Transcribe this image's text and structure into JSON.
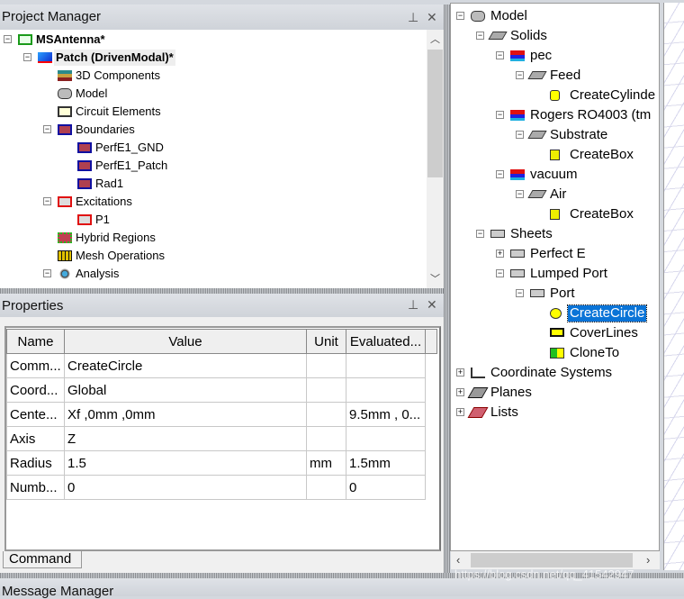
{
  "project_manager": {
    "title": "Project Manager",
    "pin_icon": "pin-icon",
    "close_icon": "close-icon",
    "items": [
      {
        "label": "MSAntenna*",
        "level": 0,
        "exp": "-",
        "icon": "project-icon",
        "bold": true
      },
      {
        "label": "Patch (DrivenModal)*",
        "level": 1,
        "exp": "-",
        "icon": "design-icon",
        "bold": true,
        "highlight": true
      },
      {
        "label": "3D Components",
        "level": 2,
        "icon": "3d-components-icon"
      },
      {
        "label": "Model",
        "level": 2,
        "icon": "model-icon"
      },
      {
        "label": "Circuit Elements",
        "level": 2,
        "icon": "circuit-elements-icon"
      },
      {
        "label": "Boundaries",
        "level": 2,
        "exp": "-",
        "icon": "boundary-icon"
      },
      {
        "label": "PerfE1_GND",
        "level": 3,
        "icon": "boundary-icon"
      },
      {
        "label": "PerfE1_Patch",
        "level": 3,
        "icon": "boundary-icon"
      },
      {
        "label": "Rad1",
        "level": 3,
        "icon": "boundary-icon"
      },
      {
        "label": "Excitations",
        "level": 2,
        "exp": "-",
        "icon": "excitation-icon"
      },
      {
        "label": "P1",
        "level": 3,
        "icon": "excitation-icon"
      },
      {
        "label": "Hybrid Regions",
        "level": 2,
        "icon": "hybrid-regions-icon"
      },
      {
        "label": "Mesh Operations",
        "level": 2,
        "icon": "mesh-icon"
      },
      {
        "label": "Analysis",
        "level": 2,
        "exp": "-",
        "icon": "analysis-icon"
      }
    ]
  },
  "properties": {
    "title": "Properties",
    "columns": [
      "Name",
      "Value",
      "Unit",
      "Evaluated..."
    ],
    "rows": [
      [
        "Comm...",
        "CreateCircle",
        "",
        ""
      ],
      [
        "Coord...",
        "Global",
        "",
        ""
      ],
      [
        "Cente...",
        "Xf ,0mm ,0mm",
        "",
        "9.5mm , 0..."
      ],
      [
        "Axis",
        "Z",
        "",
        ""
      ],
      [
        "Radius",
        "1.5",
        "mm",
        "1.5mm"
      ],
      [
        "Numb...",
        "0",
        "",
        "0"
      ]
    ],
    "tab": "Command"
  },
  "message_manager": {
    "title": "Message Manager"
  },
  "model_tree": {
    "items": [
      {
        "label": "Model",
        "level": 0,
        "exp": "-",
        "icon": "model-icon"
      },
      {
        "label": "Solids",
        "level": 1,
        "exp": "-",
        "icon": "solid-icon"
      },
      {
        "label": "pec",
        "level": 2,
        "exp": "-",
        "icon": "material-icon"
      },
      {
        "label": "Feed",
        "level": 3,
        "exp": "-",
        "icon": "solid-icon"
      },
      {
        "label": "CreateCylinde",
        "level": 4,
        "icon": "cylinder-icon"
      },
      {
        "label": "Rogers RO4003 (tm",
        "level": 2,
        "exp": "-",
        "icon": "material-icon"
      },
      {
        "label": "Substrate",
        "level": 3,
        "exp": "-",
        "icon": "solid-icon"
      },
      {
        "label": "CreateBox",
        "level": 4,
        "icon": "box-icon"
      },
      {
        "label": "vacuum",
        "level": 2,
        "exp": "-",
        "icon": "material-icon"
      },
      {
        "label": "Air",
        "level": 3,
        "exp": "-",
        "icon": "solid-icon"
      },
      {
        "label": "CreateBox",
        "level": 4,
        "icon": "box-icon"
      },
      {
        "label": "Sheets",
        "level": 1,
        "exp": "-",
        "icon": "sheet-icon"
      },
      {
        "label": "Perfect E",
        "level": 2,
        "exp": "+",
        "icon": "sheet-icon"
      },
      {
        "label": "Lumped Port",
        "level": 2,
        "exp": "-",
        "icon": "sheet-icon"
      },
      {
        "label": "Port",
        "level": 3,
        "exp": "-",
        "icon": "sheet-icon"
      },
      {
        "label": "CreateCircle",
        "level": 4,
        "icon": "circle-icon",
        "selected": true
      },
      {
        "label": "CoverLines",
        "level": 4,
        "icon": "cover-lines-icon"
      },
      {
        "label": "CloneTo",
        "level": 4,
        "icon": "clone-icon"
      },
      {
        "label": "Coordinate Systems",
        "level": 0,
        "exp": "+",
        "icon": "coordinate-systems-icon"
      },
      {
        "label": "Planes",
        "level": 0,
        "exp": "+",
        "icon": "planes-icon"
      },
      {
        "label": "Lists",
        "level": 0,
        "exp": "+",
        "icon": "lists-icon"
      }
    ]
  },
  "watermark": "https://blog.csdn.net/qq_41542947"
}
